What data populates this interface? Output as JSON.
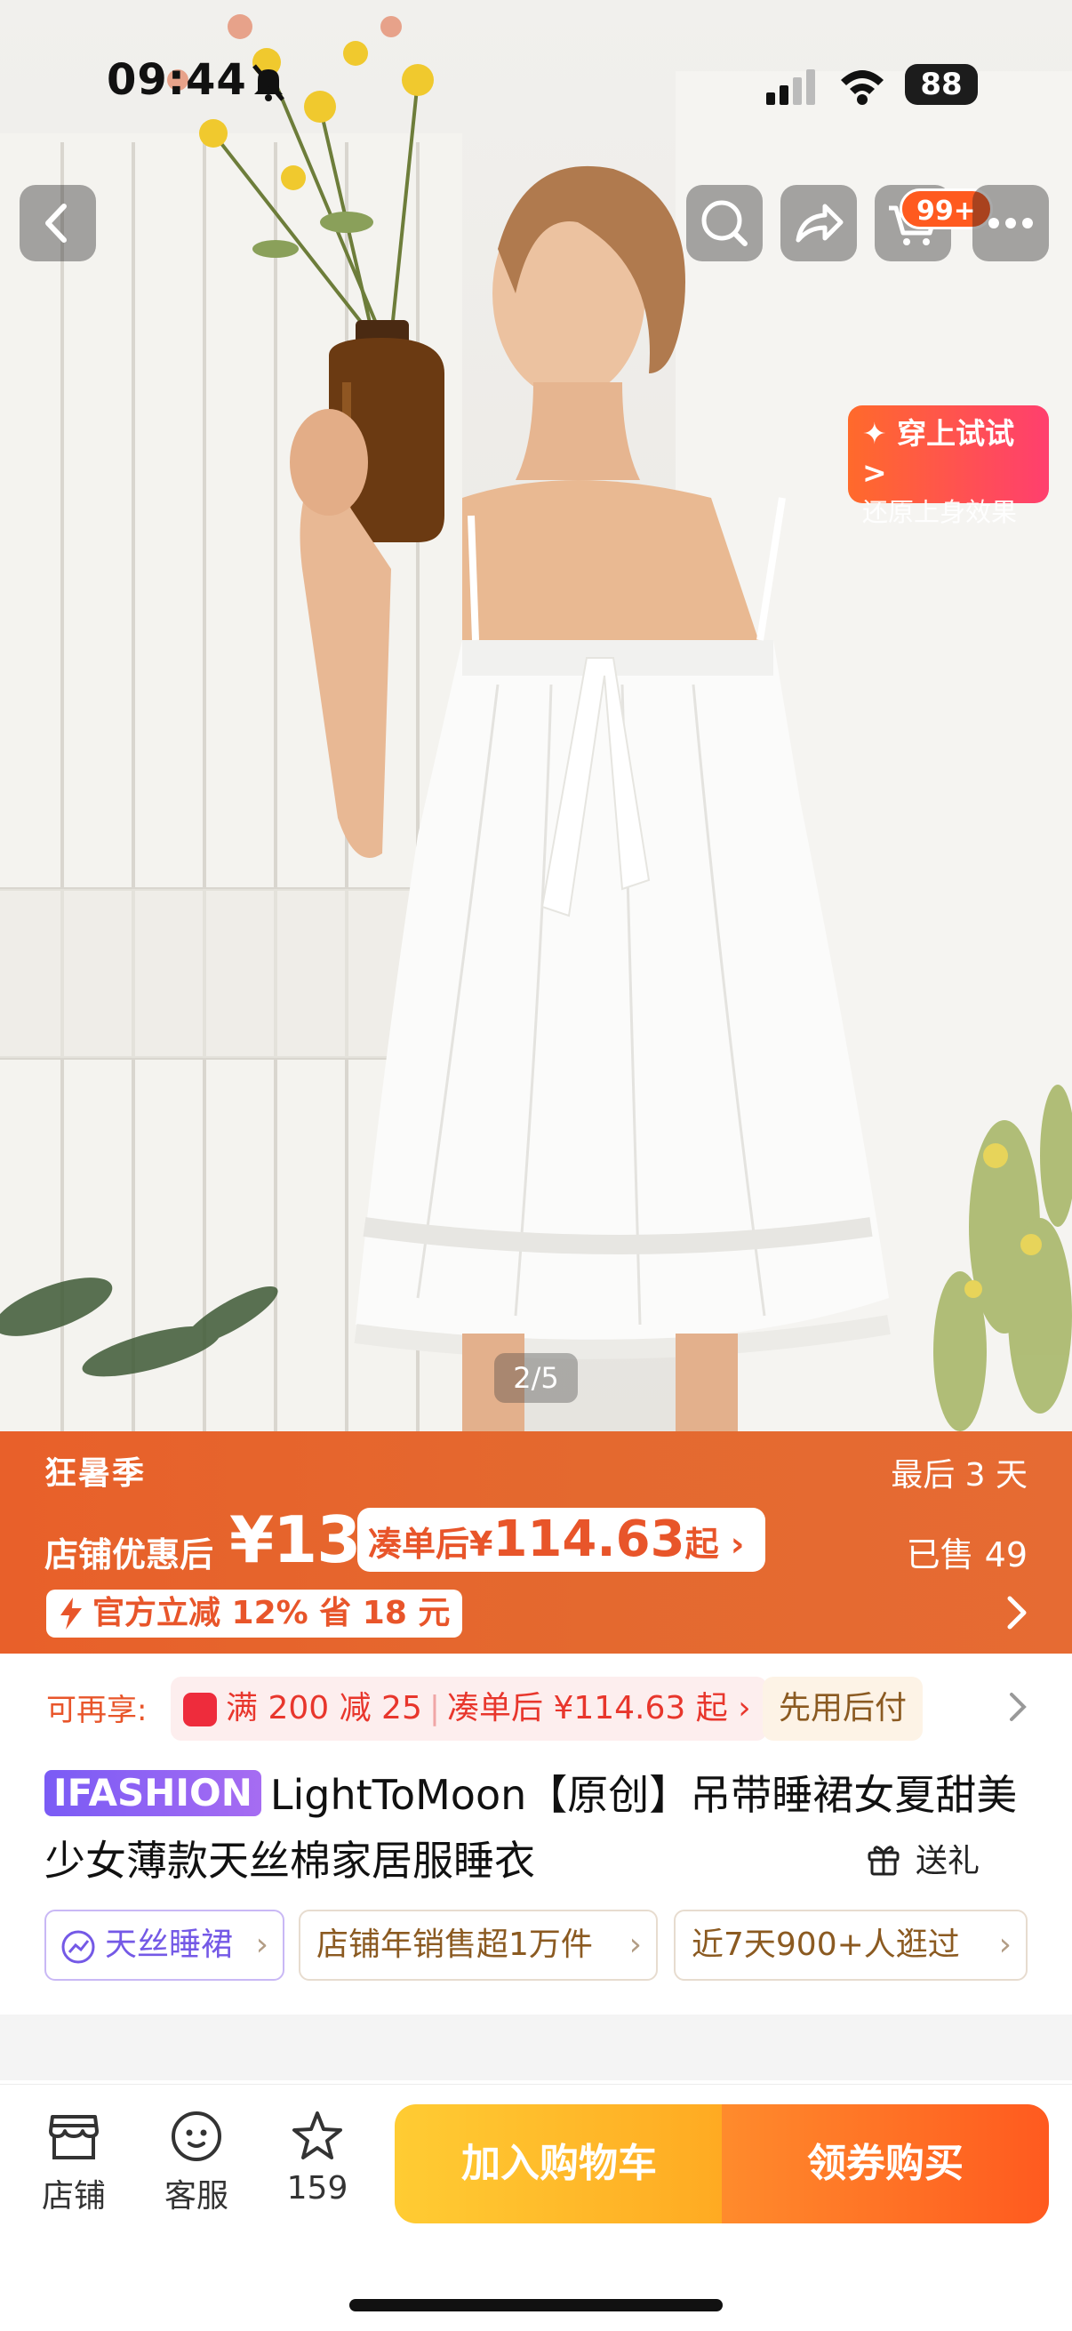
{
  "status_bar": {
    "time": "09:44",
    "battery": "88"
  },
  "nav": {
    "cart_badge": "99+"
  },
  "try_on": {
    "title": "✦ 穿上试试 >",
    "subtitle": "还原上身效果"
  },
  "gallery": {
    "counter": "2/5"
  },
  "promo": {
    "campaign": "狂暑季",
    "countdown": "最后 3 天",
    "after_discount_label": "店铺优惠后",
    "after_discount_price": "¥131",
    "combo_prefix": "凑单后¥",
    "combo_price": "114.63",
    "combo_suffix": "起 ›",
    "sold": "已售 49",
    "official_discount": "官方立减 12% 省 18 元"
  },
  "offers": {
    "label": "可再享:",
    "coupon": "满 200 减 25",
    "coupon_combo": "凑单后 ¥114.63 起 ›",
    "bnpl": "先用后付"
  },
  "product": {
    "brand_badge": "IFASHION",
    "title": "LightToMoon【原创】吊带睡裙女夏甜美少女薄款天丝棉家居服睡衣",
    "gift": "送礼"
  },
  "tags": [
    {
      "label": "天丝睡裙"
    },
    {
      "label": "店铺年销售超1万件"
    },
    {
      "label": "近7天900+人逛过"
    }
  ],
  "bottom_bar": {
    "shop": "店铺",
    "service": "客服",
    "favorites_count": "159",
    "add_to_cart": "加入购物车",
    "buy": "领券购买"
  },
  "colors": {
    "accent": "#e8602a",
    "brand_purple": "#7a5bf5",
    "cart_button": "#ffbb2a",
    "buy_button": "#ff5a1f"
  }
}
